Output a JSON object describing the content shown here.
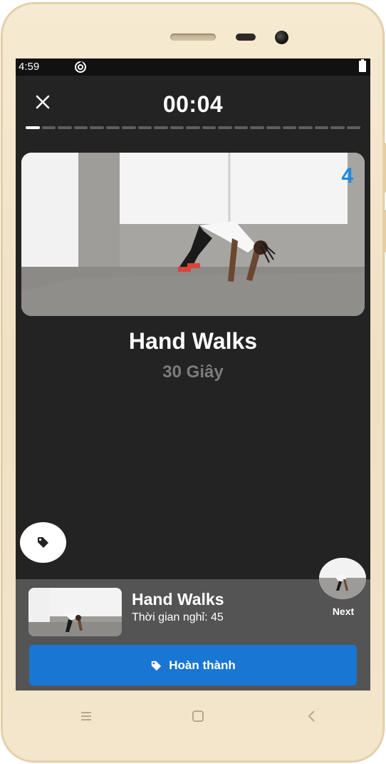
{
  "status_bar": {
    "time": "4:59"
  },
  "workout": {
    "timer": "00:04",
    "progress": {
      "total_segments": 21,
      "current_index": 0
    },
    "video": {
      "rep_counter": "4"
    },
    "exercise_name": "Hand Walks",
    "exercise_duration": "30 Giây"
  },
  "next_up": {
    "name": "Hand Walks",
    "rest_label": "Thời gian nghỉ: 45",
    "next_label": "Next"
  },
  "actions": {
    "done_label": "Hoàn thành"
  },
  "colors": {
    "accent": "#1976d2",
    "counter": "#1e88e5",
    "screen_bg": "#232323",
    "panel_bg": "#545454"
  },
  "icons": {
    "close": "close-icon",
    "tag": "tag-icon",
    "menu": "menu-icon",
    "home": "home-icon",
    "back": "back-icon"
  }
}
